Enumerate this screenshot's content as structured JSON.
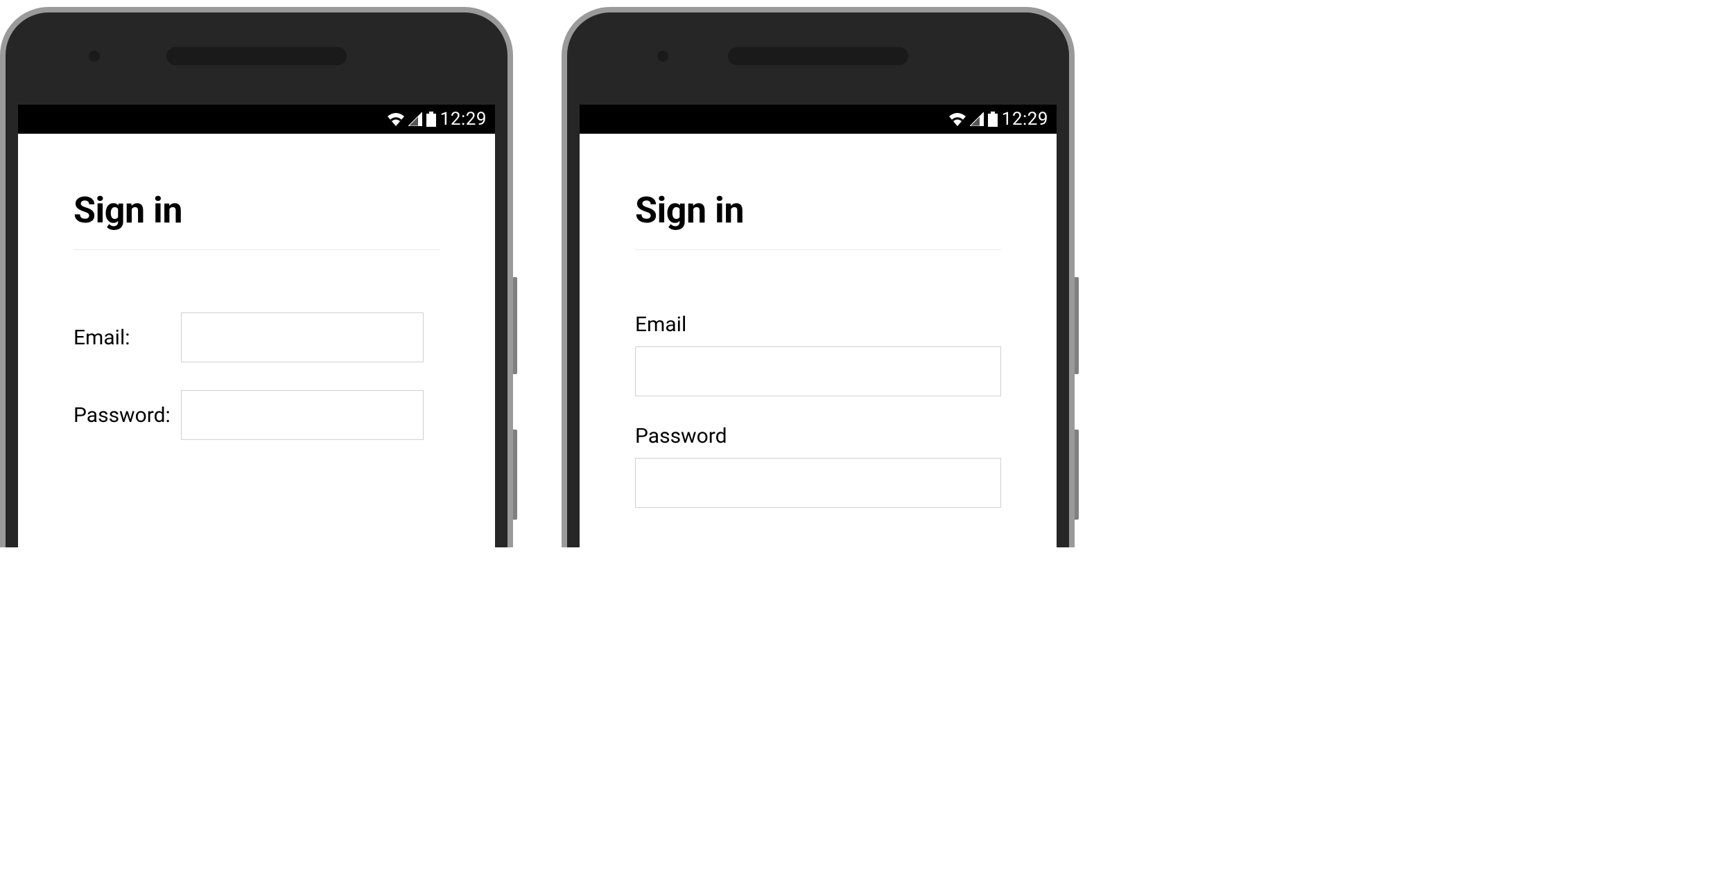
{
  "statusBar": {
    "time": "12:29"
  },
  "left": {
    "title": "Sign in",
    "emailLabel": "Email:",
    "passwordLabel": "Password:"
  },
  "right": {
    "title": "Sign in",
    "emailLabel": "Email",
    "passwordLabel": "Password"
  }
}
